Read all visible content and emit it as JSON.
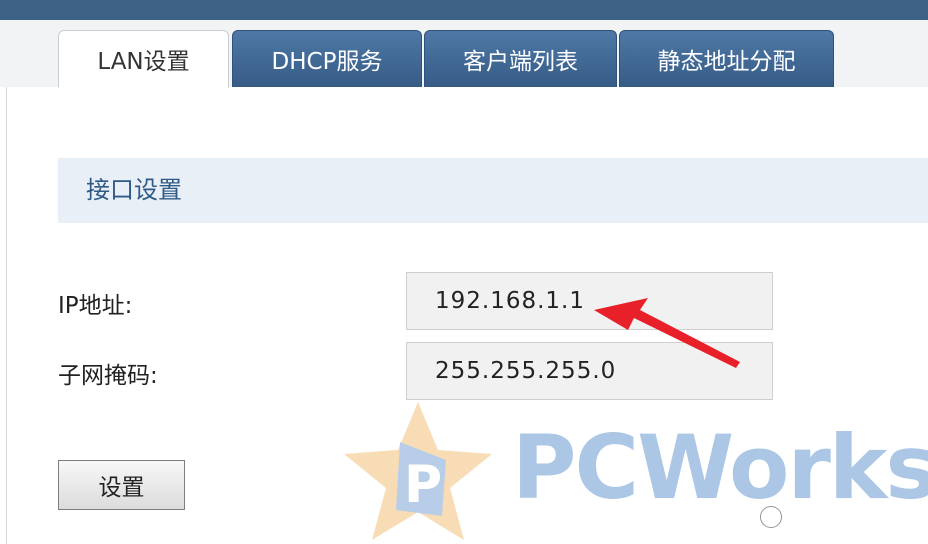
{
  "tabs": [
    {
      "label": "LAN设置",
      "active": true
    },
    {
      "label": "DHCP服务",
      "active": false
    },
    {
      "label": "客户端列表",
      "active": false
    },
    {
      "label": "静态地址分配",
      "active": false
    }
  ],
  "section": {
    "title": "接口设置"
  },
  "fields": {
    "ip": {
      "label": "IP地址:",
      "value": "192.168.1.1"
    },
    "mask": {
      "label": "子网掩码:",
      "value": "255.255.255.0"
    }
  },
  "button": {
    "label": "设置"
  },
  "watermark": {
    "text": "PCWorks",
    "logo_letter": "P"
  },
  "colors": {
    "header_bar": "#3e6186",
    "tab_inactive": "#4a71a0",
    "section_bg": "#e8eff6",
    "section_title": "#2f5a86",
    "arrow": "#e8202a",
    "watermark": "#8fb5dd"
  }
}
